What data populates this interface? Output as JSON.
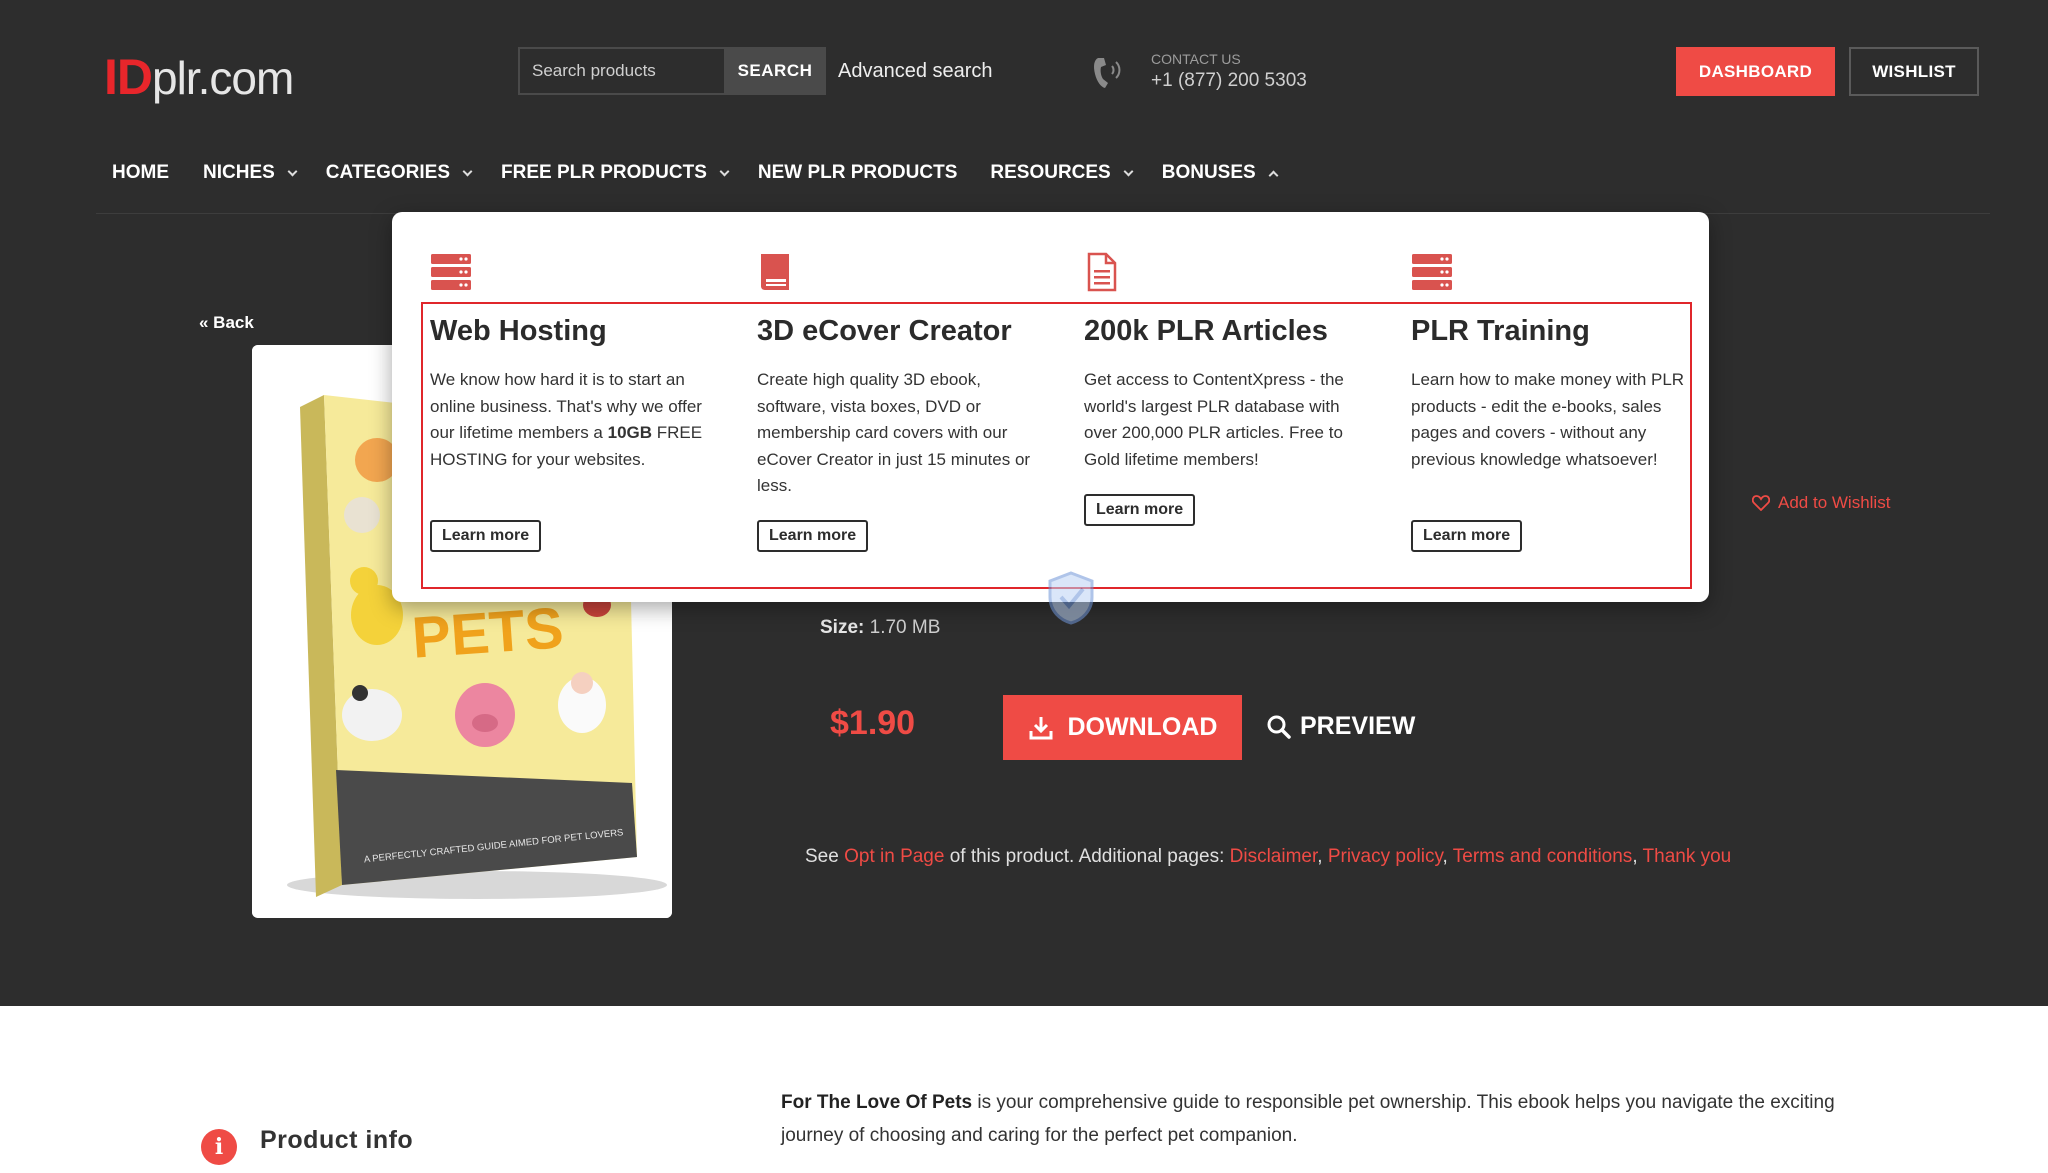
{
  "header": {
    "logo_id": "ID",
    "logo_rest": "plr.com",
    "search_placeholder": "Search products",
    "search_button": "SEARCH",
    "advanced_search": "Advanced search",
    "contact_label": "CONTACT US",
    "contact_phone": "+1 (877) 200 5303",
    "dashboard": "DASHBOARD",
    "wishlist": "WISHLIST"
  },
  "nav": [
    {
      "label": "HOME",
      "dropdown": false
    },
    {
      "label": "NICHES",
      "dropdown": true
    },
    {
      "label": "CATEGORIES",
      "dropdown": true
    },
    {
      "label": "FREE PLR PRODUCTS",
      "dropdown": true
    },
    {
      "label": "NEW PLR PRODUCTS",
      "dropdown": false
    },
    {
      "label": "RESOURCES",
      "dropdown": true
    },
    {
      "label": "BONUSES",
      "dropdown": true,
      "open": true
    }
  ],
  "bonuses": [
    {
      "icon": "server-icon",
      "title": "Web Hosting",
      "text_html": "We know how hard it is to start an online business. That's why we offer our lifetime members a <b>10GB</b> FREE HOSTING for your websites.",
      "button": "Learn more"
    },
    {
      "icon": "book-icon",
      "title": "3D eCover Creator",
      "text_html": "Create high quality 3D ebook, software, vista boxes, DVD or membership card covers with our eCover Creator in just 15 minutes or less.",
      "button": "Learn more"
    },
    {
      "icon": "document-icon",
      "title": "200k PLR Articles",
      "text_html": "Get access to ContentXpress - the world's largest PLR database with over 200,000 PLR articles. Free to Gold lifetime members!",
      "button": "Learn more"
    },
    {
      "icon": "server-icon",
      "title": "PLR Training",
      "text_html": "Learn how to make money with PLR products - edit the e-books, sales pages and covers - without any previous knowledge whatsoever!",
      "button": "Learn more"
    }
  ],
  "product": {
    "back": "« Back",
    "cover_title": "PETS",
    "cover_tagline": "A PERFECTLY CRAFTED GUIDE AIMED FOR PET LOVERS",
    "add_to_wishlist": "Add to Wishlist",
    "size_label": "Size:",
    "size_value": "1.70 MB",
    "price": "$1.90",
    "download": "DOWNLOAD",
    "preview": "PREVIEW",
    "see_prefix": "See ",
    "optin": "Opt in Page",
    "see_middle": " of this product. Additional pages: ",
    "disclaimer": "Disclaimer",
    "privacy": "Privacy policy",
    "terms": "Terms and conditions",
    "thankyou": "Thank you",
    "sep": ", "
  },
  "info": {
    "icon_letter": "i",
    "heading": "Product info",
    "desc_bold": "For The Love Of Pets",
    "desc_rest": " is your comprehensive guide to responsible pet ownership. This ebook helps you navigate the exciting journey of choosing and caring for the perfect pet companion."
  },
  "colors": {
    "dark_bg": "#2d2d2d",
    "accent": "#ef4b45",
    "highlight": "#e0262b"
  }
}
